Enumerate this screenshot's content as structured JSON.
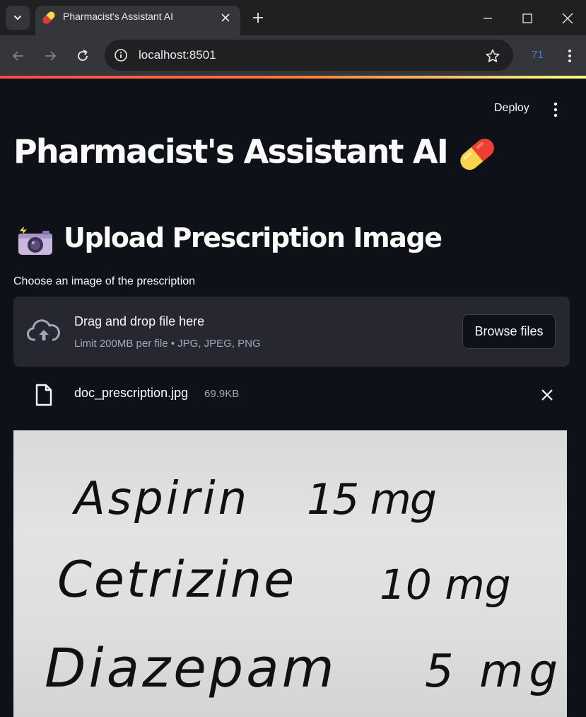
{
  "browser": {
    "tab_title": "Pharmacist's Assistant AI",
    "url": "localhost:8501",
    "extension_badge": "71"
  },
  "app": {
    "deploy_label": "Deploy",
    "title": "Pharmacist's Assistant AI",
    "title_icon": "pill-icon",
    "section_title": "Upload Prescription Image",
    "section_icon": "camera-flash-icon",
    "uploader": {
      "label": "Choose an image of the prescription",
      "drop_title": "Drag and drop file here",
      "limit_text": "Limit 200MB per file • JPG, JPEG, PNG",
      "browse_label": "Browse files"
    },
    "uploaded_file": {
      "name": "doc_prescription.jpg",
      "size": "69.9KB"
    },
    "prescription": [
      {
        "drug": "Aspirin",
        "dose": "15 mg"
      },
      {
        "drug": "Cetrizine",
        "dose": "10 mg"
      },
      {
        "drug": "Diazepam",
        "dose": "5 mg"
      }
    ]
  },
  "colors": {
    "background": "#0e1117",
    "surface": "#262730",
    "text": "#fafafa",
    "muted": "#a3a8b8",
    "accent": "#ff4b4b"
  }
}
